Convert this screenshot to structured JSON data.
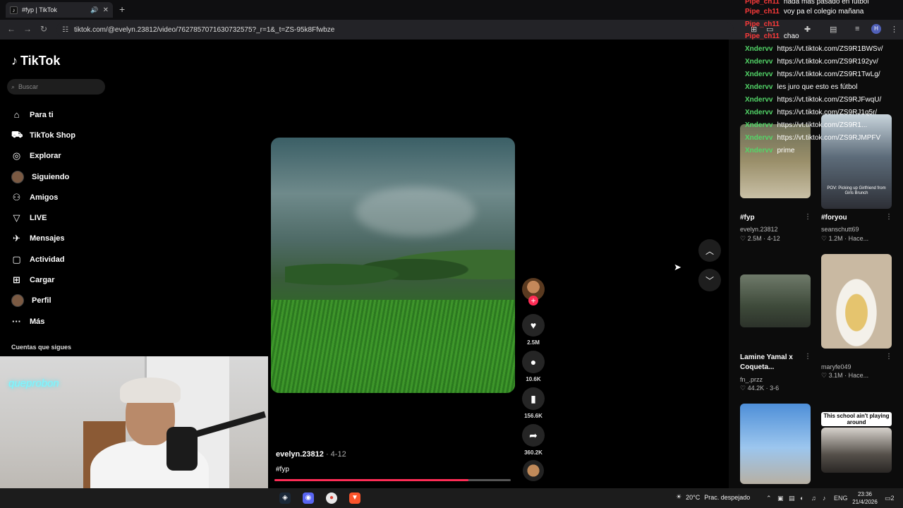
{
  "browser": {
    "tab_title": "#fyp | TikTok",
    "url": "tiktok.com/@evelyn.23812/video/7627857071630732575?_r=1&_t=ZS-95k8Ffwbze",
    "profile_initial": "H"
  },
  "sidebar": {
    "logo": "TikTok",
    "search_placeholder": "Buscar",
    "items": [
      {
        "label": "Para ti",
        "icon": "home-icon"
      },
      {
        "label": "TikTok Shop",
        "icon": "shop-bag-icon"
      },
      {
        "label": "Explorar",
        "icon": "compass-icon"
      },
      {
        "label": "Siguiendo",
        "icon": "following-avatar"
      },
      {
        "label": "Amigos",
        "icon": "friends-icon"
      },
      {
        "label": "LIVE",
        "icon": "live-icon"
      },
      {
        "label": "Mensajes",
        "icon": "messages-icon"
      },
      {
        "label": "Actividad",
        "icon": "activity-icon"
      },
      {
        "label": "Cargar",
        "icon": "upload-icon"
      },
      {
        "label": "Perfil",
        "icon": "profile-avatar"
      },
      {
        "label": "Más",
        "icon": "more-icon"
      }
    ],
    "following_heading": "Cuentas que sigues"
  },
  "webcam": {
    "neon_sign": "queprobon"
  },
  "video": {
    "author": "evelyn.23812",
    "date": " · 4-12",
    "caption": "#fyp",
    "progress": 0.82,
    "likes": "2.5M",
    "comments": "10.6K",
    "saves": "156.6K",
    "shares": "360.2K"
  },
  "recommended": [
    {
      "title": "#fyp",
      "user": "evelyn.23812",
      "likes": "2.5M",
      "when": "4-12"
    },
    {
      "title": "#foryou",
      "user": "seanschutt69",
      "likes": "1.2M",
      "when": "Hace...",
      "overlay": "POV: Picking up Girlfriend from Girls Brunch"
    },
    {
      "title": "Lamine Yamal x Coqueta...",
      "user": "fn_.przz",
      "likes": "44.2K",
      "when": "3-6"
    },
    {
      "title": "",
      "user": "maryfe049",
      "likes": "3.1M",
      "when": "Hace..."
    },
    {
      "title": "",
      "user": "",
      "likes": "",
      "when": ""
    },
    {
      "title": "",
      "user": "",
      "likes": "",
      "when": "",
      "overlay": "This school ain't playing around"
    }
  ],
  "chat": [
    {
      "user": "Pipe_ch11",
      "msg": "nada mas pasado en fútbol",
      "color": "#ff3b3b"
    },
    {
      "user": "Pipe_ch11",
      "msg": "voy pa el colegio mañana",
      "color": "#ff3b3b"
    },
    {
      "user": "Pipe_ch11",
      "msg": "",
      "color": "#ff3b3b"
    },
    {
      "user": "Pipe_ch11",
      "msg": "chao",
      "color": "#ff3b3b"
    },
    {
      "user": "Xndervv",
      "msg": "https://vt.tiktok.com/ZS9R1BWSv/",
      "color": "#53d769"
    },
    {
      "user": "Xndervv",
      "msg": "https://vt.tiktok.com/ZS9R192yv/",
      "color": "#53d769"
    },
    {
      "user": "Xndervv",
      "msg": "https://vt.tiktok.com/ZS9R1TwLg/",
      "color": "#53d769"
    },
    {
      "user": "Xndervv",
      "msg": "les juro que esto es fútbol",
      "color": "#53d769"
    },
    {
      "user": "Xndervv",
      "msg": "https://vt.tiktok.com/ZS9RJFwqU/",
      "color": "#53d769"
    },
    {
      "user": "Xndervv",
      "msg": "https://vt.tiktok.com/ZS9RJ1q5r/",
      "color": "#53d769"
    },
    {
      "user": "Xndervv",
      "msg": "https://vt.tiktok.com/ZS9R1...",
      "color": "#53d769"
    },
    {
      "user": "Xndervv",
      "msg": "https://vt.tiktok.com/ZS9RJMPFV",
      "color": "#53d769"
    },
    {
      "user": "Xndervv",
      "msg": "prime",
      "color": "#53d769"
    }
  ],
  "taskbar": {
    "weather_temp": "20°C",
    "weather_desc": "Prac. despejado",
    "lang": "ENG",
    "time": "23:36",
    "date": "21/4/2026",
    "notif_count": "2"
  },
  "colors": {
    "accent": "#fe2c55",
    "chat_red": "#ff3b3b",
    "chat_green": "#53d769"
  }
}
